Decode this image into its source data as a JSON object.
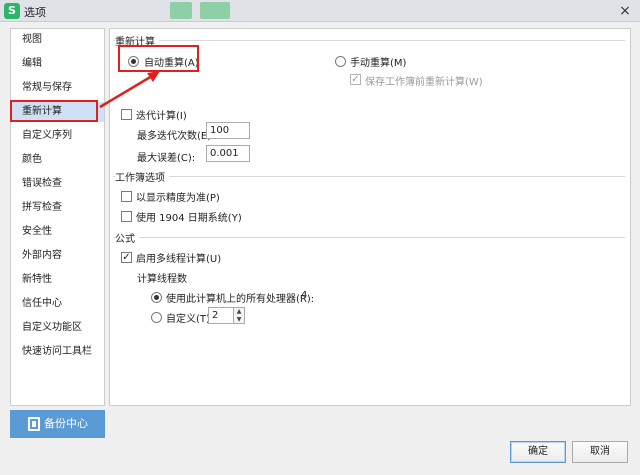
{
  "window": {
    "title": "选项",
    "logo": "S",
    "close_icon": "×"
  },
  "sidebar": {
    "items": [
      {
        "label": "视图"
      },
      {
        "label": "编辑"
      },
      {
        "label": "常规与保存"
      },
      {
        "label": "重新计算",
        "selected": true
      },
      {
        "label": "自定义序列"
      },
      {
        "label": "颜色"
      },
      {
        "label": "错误检查"
      },
      {
        "label": "拼写检查"
      },
      {
        "label": "安全性"
      },
      {
        "label": "外部内容"
      },
      {
        "label": "新特性"
      },
      {
        "label": "信任中心"
      },
      {
        "label": "自定义功能区"
      },
      {
        "label": "快速访问工具栏"
      }
    ],
    "backup_label": "备份中心"
  },
  "recalc": {
    "section_title": "重新计算",
    "auto_label": "自动重算(A)",
    "auto_checked": true,
    "manual_label": "手动重算(M)",
    "manual_checked": false,
    "save_recalc_label": "保存工作簿前重新计算(W)",
    "save_recalc_checked": true,
    "iteration_label": "迭代计算(I)",
    "iteration_checked": false,
    "max_iter_label": "最多迭代次数(E):",
    "max_iter_value": "100",
    "max_change_label": "最大误差(C):",
    "max_change_value": "0.001"
  },
  "workbook": {
    "section_title": "工作簿选项",
    "precision_label": "以显示精度为准(P)",
    "precision_checked": false,
    "date1904_label": "使用 1904 日期系统(Y)",
    "date1904_checked": false
  },
  "formula": {
    "section_title": "公式",
    "multithread_label": "启用多线程计算(U)",
    "multithread_checked": true,
    "threads_title": "计算线程数",
    "all_processors_label": "使用此计算机上的所有处理器(R):",
    "all_processors_value": "4",
    "all_processors_checked": true,
    "custom_label": "自定义(T)",
    "custom_value": "2",
    "custom_checked": false
  },
  "footer": {
    "ok_label": "确定",
    "cancel_label": "取消"
  },
  "colors": {
    "highlight": "#e02020",
    "selected_bg": "#cfe0f4",
    "backup_bg": "#5b9bd5"
  }
}
